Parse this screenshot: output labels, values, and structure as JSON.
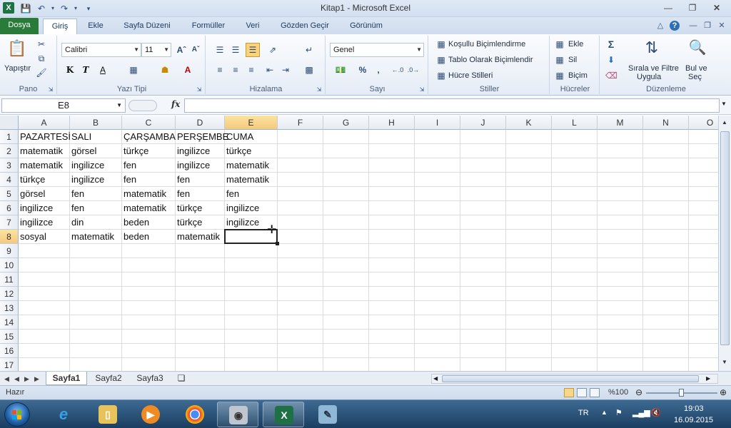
{
  "window": {
    "title": "Kitap1  -  Microsoft Excel",
    "app_icon_letter": "X"
  },
  "ribbon_tabs": [
    "Dosya",
    "Giriş",
    "Ekle",
    "Sayfa Düzeni",
    "Formüller",
    "Veri",
    "Gözden Geçir",
    "Görünüm"
  ],
  "ribbon": {
    "clipboard": {
      "paste_label": "Yapıştır",
      "group": "Pano"
    },
    "font": {
      "name": "Calibri",
      "size": "11",
      "bold": "K",
      "italic": "T",
      "underline": "A",
      "group": "Yazı Tipi"
    },
    "alignment": {
      "group": "Hizalama"
    },
    "number": {
      "format": "Genel",
      "percent": "%",
      "comma": ",",
      "group": "Sayı"
    },
    "styles": {
      "conditional": "Koşullu Biçimlendirme",
      "table": "Tablo Olarak Biçimlendir",
      "cell_styles": "Hücre Stilleri",
      "group": "Stiller"
    },
    "cells": {
      "insert": "Ekle",
      "delete": "Sil",
      "format": "Biçim",
      "group": "Hücreler"
    },
    "editing": {
      "sum_symbol": "Σ",
      "sort_line1": "Sırala ve Filtre",
      "sort_line2": "Uygula",
      "find_line1": "Bul ve",
      "find_line2": "Seç",
      "group": "Düzenleme"
    }
  },
  "formula_bar": {
    "name_box": "E8",
    "fx": "fx",
    "value": ""
  },
  "columns": [
    "A",
    "B",
    "C",
    "D",
    "E",
    "F",
    "G",
    "H",
    "I",
    "J",
    "K",
    "L",
    "M",
    "N",
    "O"
  ],
  "rows": [
    "1",
    "2",
    "3",
    "4",
    "5",
    "6",
    "7",
    "8",
    "9",
    "10",
    "11",
    "12",
    "13",
    "14",
    "15",
    "16",
    "17"
  ],
  "cells": [
    [
      "PAZARTESİ",
      "SALI",
      "ÇARŞAMBA",
      "PERŞEMBE",
      "CUMA"
    ],
    [
      "matematik",
      "görsel",
      "türkçe",
      "ingilizce",
      "türkçe"
    ],
    [
      "matematik",
      "ingilizce",
      "fen",
      "ingilizce",
      "matematik"
    ],
    [
      "türkçe",
      "ingilizce",
      "fen",
      "fen",
      "matematik"
    ],
    [
      "görsel",
      "fen",
      "matematik",
      "fen",
      "fen"
    ],
    [
      "ingilizce",
      "fen",
      "matematik",
      "türkçe",
      "ingilizce"
    ],
    [
      "ingilizce",
      "din",
      "beden",
      "türkçe",
      "ingilizce"
    ],
    [
      "sosyal",
      "matematik",
      "beden",
      "matematik",
      ""
    ]
  ],
  "active_cell": "E8",
  "sheets": [
    "Sayfa1",
    "Sayfa2",
    "Sayfa3"
  ],
  "status": {
    "ready": "Hazır",
    "zoom": "%100"
  },
  "taskbar": {
    "language": "TR",
    "time": "19:03",
    "date": "16.09.2015"
  }
}
